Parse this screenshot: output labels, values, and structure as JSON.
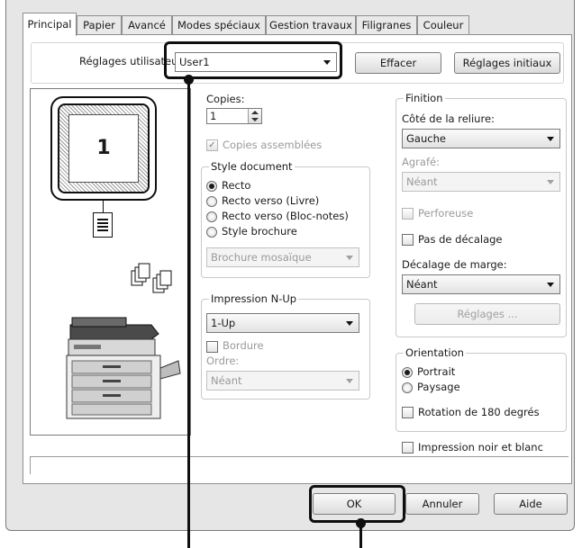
{
  "tabs": [
    "Principal",
    "Papier",
    "Avancé",
    "Modes spéciaux",
    "Gestion travaux",
    "Filigranes",
    "Couleur"
  ],
  "user_settings": {
    "label": "Réglages utilisateur",
    "value": "User1",
    "clear_button": "Effacer",
    "reset_button": "Réglages initiaux"
  },
  "preview": {
    "page_number": "1"
  },
  "copies": {
    "label": "Copies:",
    "value": "1",
    "collate_label": "Copies assemblées"
  },
  "document_style": {
    "title": "Style document",
    "options": [
      "Recto",
      "Recto verso (Livre)",
      "Recto verso (Bloc-notes)",
      "Style brochure"
    ],
    "selected": "Recto",
    "brochure_value": "Brochure mosaïque"
  },
  "nup": {
    "title": "Impression N-Up",
    "value": "1-Up",
    "border_label": "Bordure",
    "order_label": "Ordre:",
    "order_value": "Néant"
  },
  "finishing": {
    "title": "Finition",
    "binding_label": "Côté de la reliure:",
    "binding_value": "Gauche",
    "staple_label": "Agrafé:",
    "staple_value": "Néant",
    "punch_label": "Perforeuse",
    "no_offset_label": "Pas de décalage",
    "margin_label": "Décalage de marge:",
    "margin_value": "Néant",
    "settings_button": "Réglages ..."
  },
  "orientation": {
    "title": "Orientation",
    "options": [
      "Portrait",
      "Paysage"
    ],
    "selected": "Portrait",
    "rotate_label": "Rotation de 180 degrés"
  },
  "bw_label": "Impression noir et blanc",
  "footer": {
    "ok": "OK",
    "cancel": "Annuler",
    "help": "Aide"
  }
}
